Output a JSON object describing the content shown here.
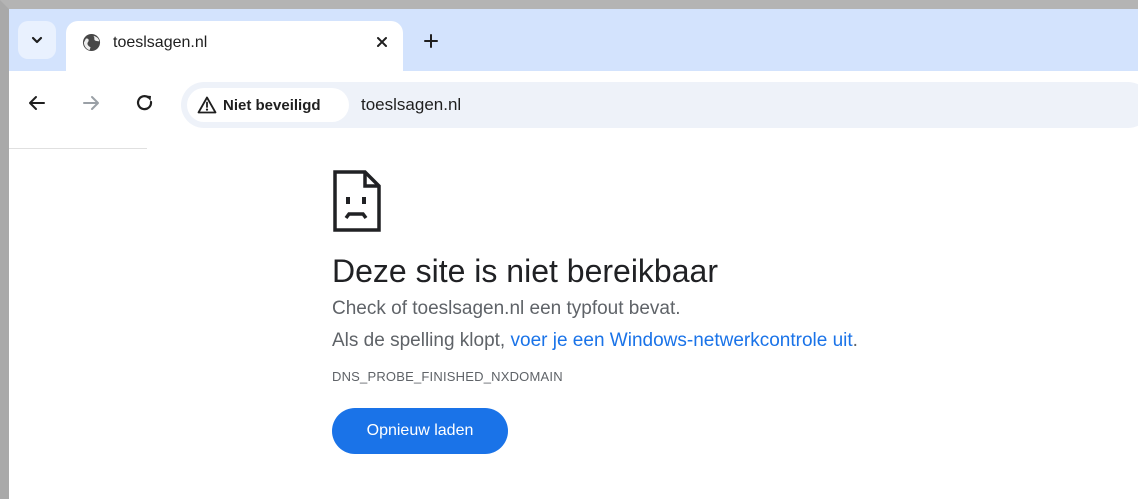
{
  "tabstrip": {
    "tab_title": "toeslsagen.nl"
  },
  "toolbar": {
    "security_label": "Niet beveiligd",
    "url": "toeslsagen.nl"
  },
  "error": {
    "title": "Deze site is niet bereikbaar",
    "line1": "Check of toeslsagen.nl een typfout bevat.",
    "line2_prefix": "Als de spelling klopt, ",
    "line2_link": "voer je een Windows-netwerkcontrole uit",
    "line2_suffix": ".",
    "code": "DNS_PROBE_FINISHED_NXDOMAIN",
    "reload_label": "Opnieuw laden"
  },
  "colors": {
    "tabstrip_bg": "#d3e3fd",
    "omnibox_bg": "#eef2f9",
    "accent": "#1a73e8",
    "title_text": "#202124",
    "secondary_text": "#5f6368"
  },
  "icons": {
    "tab_search": "chevron-down-icon",
    "favicon": "globe-icon",
    "tab_close": "close-icon",
    "new_tab": "plus-icon",
    "back": "arrow-left-icon",
    "forward": "arrow-right-icon",
    "reload": "reload-icon",
    "security": "warning-triangle-icon",
    "error": "sad-page-icon"
  }
}
